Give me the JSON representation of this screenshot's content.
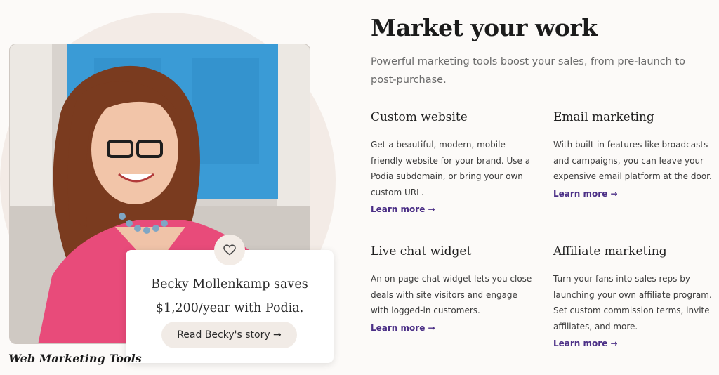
{
  "hero": {
    "title": "Market your work",
    "subtitle": "Powerful marketing tools boost your sales, from pre-launch to post-purchase."
  },
  "features": [
    {
      "title": "Custom website",
      "description": "Get a beautiful, modern, mobile-friendly website for your brand. Use a Podia subdomain, or bring your own custom URL.",
      "link": "Learn more →"
    },
    {
      "title": "Email marketing",
      "description": "With built-in features like broadcasts and campaigns, you can leave your expensive email platform at the door.",
      "link": "Learn more →"
    },
    {
      "title": "Live chat widget",
      "description": "An on-page chat widget lets you close deals with site visitors and engage with logged-in customers.",
      "link": "Learn more →"
    },
    {
      "title": "Affiliate marketing",
      "description": "Turn your fans into sales reps by launching your own affiliate program. Set custom commission terms, invite affiliates, and more.",
      "link": "Learn more →"
    }
  ],
  "testimonial": {
    "quote": "Becky Mollenkamp saves $1,200/year with Podia.",
    "button_label": "Read Becky's story →"
  },
  "watermark": "Web Marketing Tools",
  "colors": {
    "accent_link": "#4b2f86",
    "background": "#fcfaf8",
    "card_button": "#f1ebe6"
  }
}
